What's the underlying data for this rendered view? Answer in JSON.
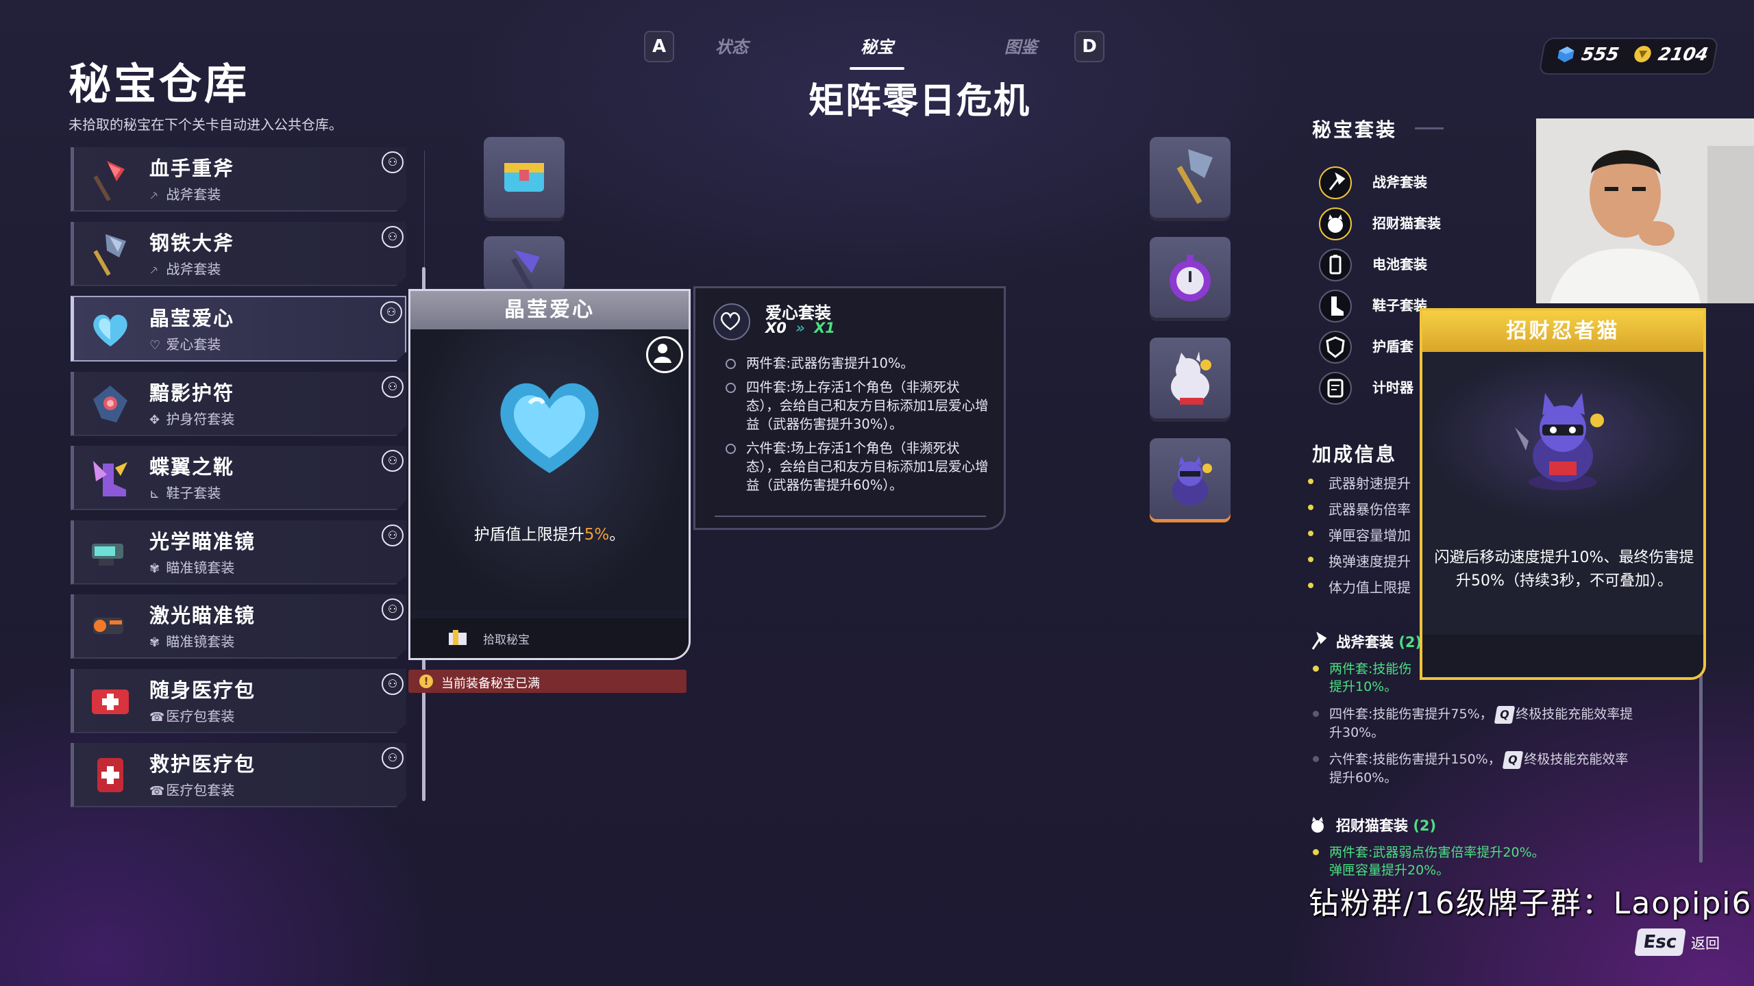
{
  "page": {
    "title": "秘宝仓库",
    "subtitle": "未拾取的秘宝在下个关卡自动进入公共仓库。",
    "level_title": "矩阵零日危机"
  },
  "nav": {
    "left_key": "A",
    "right_key": "D",
    "tabs": [
      "状态",
      "秘宝",
      "图鉴"
    ],
    "active_tab": "秘宝"
  },
  "currency": {
    "cubes": "555",
    "coins": "2104"
  },
  "items": [
    {
      "name": "血手重斧",
      "set": "战斧套装",
      "set_icon": "axe-icon",
      "selected": false
    },
    {
      "name": "钢铁大斧",
      "set": "战斧套装",
      "set_icon": "axe-icon",
      "selected": false
    },
    {
      "name": "晶莹爱心",
      "set": "爱心套装",
      "set_icon": "heart-icon",
      "selected": true
    },
    {
      "name": "黯影护符",
      "set": "护身符套装",
      "set_icon": "amulet-icon",
      "selected": false
    },
    {
      "name": "蝶翼之靴",
      "set": "鞋子套装",
      "set_icon": "boot-icon",
      "selected": false
    },
    {
      "name": "光学瞄准镜",
      "set": "瞄准镜套装",
      "set_icon": "scope-icon",
      "selected": false
    },
    {
      "name": "激光瞄准镜",
      "set": "瞄准镜套装",
      "set_icon": "scope-icon",
      "selected": false
    },
    {
      "name": "随身医疗包",
      "set": "医疗包套装",
      "set_icon": "medkit-icon",
      "selected": false
    },
    {
      "name": "救护医疗包",
      "set": "医疗包套装",
      "set_icon": "medkit-icon",
      "selected": false
    }
  ],
  "detail": {
    "name": "晶莹爱心",
    "desc_before": "护盾值上限提升",
    "desc_value": "5%",
    "desc_after": "。",
    "footer_label": "拾取秘宝",
    "warning": "当前装备秘宝已满"
  },
  "set_tooltip": {
    "title": "爱心套装",
    "count_from": "X0",
    "count_to": "X1",
    "lines": [
      "两件套:武器伤害提升10%。",
      "四件套:场上存活1个角色（非濒死状态），会给自己和友方目标添加1层爱心增益（武器伤害提升30%）。",
      "六件套:场上存活1个角色（非濒死状态），会给自己和友方目标添加1层爱心增益（武器伤害提升60%）。"
    ]
  },
  "right_panel": {
    "suits_title": "秘宝套装",
    "suits": [
      "战斧套装",
      "招财猫套装",
      "电池套装",
      "鞋子套装",
      "护盾套",
      "计时器"
    ],
    "bonus_title": "加成信息",
    "bonus": [
      "武器射速提升",
      "武器暴伤倍率",
      "弹匣容量增加",
      "换弹速度提升",
      "体力值上限提"
    ],
    "group1_title": "战斧套装",
    "group1_count": "(2)",
    "group1_effects": [
      {
        "text": "两件套:技能伤",
        "text2": "提升10%。",
        "active": true
      },
      {
        "text": "四件套:技能伤害提升75%，",
        "key": "Q",
        "after": "终极技能充能效率提",
        "text2": "升30%。",
        "active": false
      },
      {
        "text": "六件套:技能伤害提升150%，",
        "key": "Q",
        "after": "终极技能充能效率",
        "text2": "提升60%。",
        "active": false
      }
    ],
    "group2_title": "招财猫套装",
    "group2_count": "(2)",
    "group2_effects": [
      {
        "text": "两件套:武器弱点伤害倍率提升20%。",
        "text2": "弹匣容量提升20%。",
        "active": true
      }
    ]
  },
  "cat_card": {
    "title": "招财忍者猫",
    "desc": "闪避后移动速度提升10%、最终伤害提升50%（持续3秒，不可叠加）。"
  },
  "overlay": {
    "stream_text": "钻粉群/16级牌子群：Laopipi6"
  },
  "footer": {
    "esc_key": "Esc",
    "esc_label": "返回"
  },
  "colors": {
    "accent_orange": "#f3a23a",
    "set_green": "#4ce081",
    "cat_gold": "#f0c43a",
    "warning_red": "#7a2b2e"
  }
}
